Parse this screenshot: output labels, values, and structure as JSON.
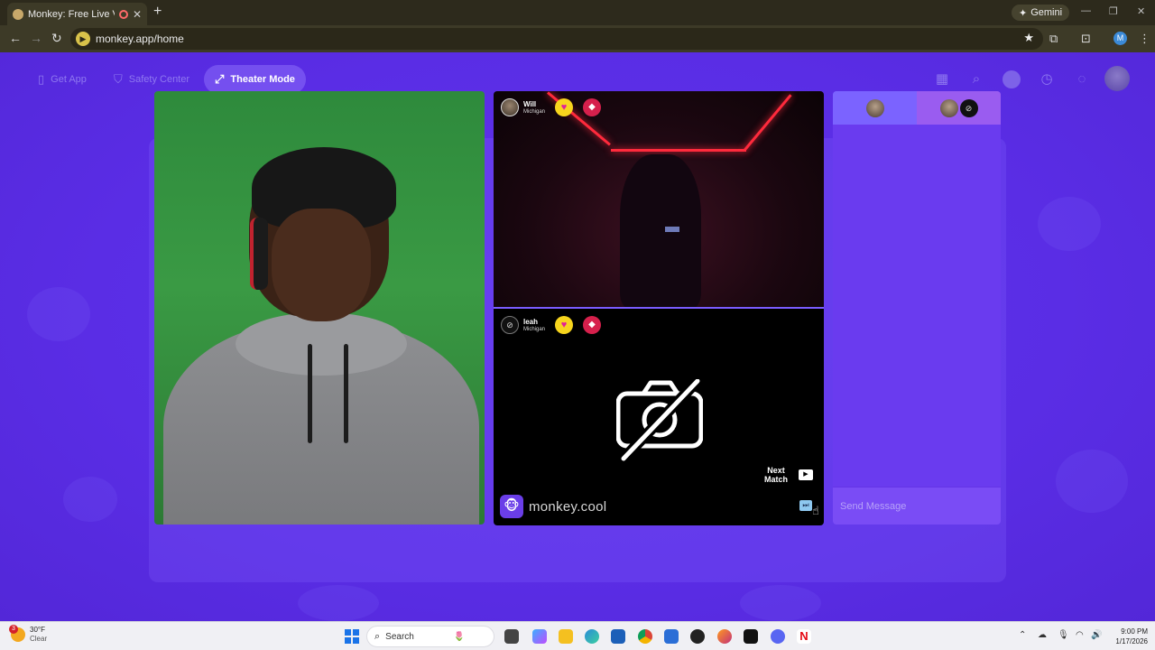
{
  "browser": {
    "tab_title": "Monkey: Free Live Video Ch",
    "new_tab": "+",
    "gemini_label": "Gemini",
    "url": "monkey.app/home",
    "profile_initial": "M"
  },
  "nav": {
    "get_app": "Get App",
    "safety_center": "Safety Center",
    "theater_mode": "Theater Mode"
  },
  "matches": [
    {
      "name": "Will",
      "location": "Michigan"
    },
    {
      "name": "leah",
      "location": "Michigan"
    }
  ],
  "call": {
    "next_match_line1": "Next",
    "next_match_line2": "Match",
    "brand": "monkey.cool"
  },
  "chat": {
    "placeholder": "Send Message"
  },
  "taskbar": {
    "weather_badge": "3",
    "temperature": "30°F",
    "condition": "Clear",
    "search_label": "Search",
    "time": "9:00 PM",
    "date": "1/17/2026"
  },
  "colors": {
    "page_bg": "#5b2ee6",
    "accent_yellow": "#f7d51d",
    "led_red": "#ff2a3c"
  },
  "icons": [
    "phone-icon",
    "shield-icon",
    "expand-icon",
    "store-icon",
    "search-icon",
    "coin-icon",
    "history-icon",
    "chat-icon",
    "camera-off-icon",
    "heart-icon",
    "badge-icon",
    "skip-icon"
  ]
}
